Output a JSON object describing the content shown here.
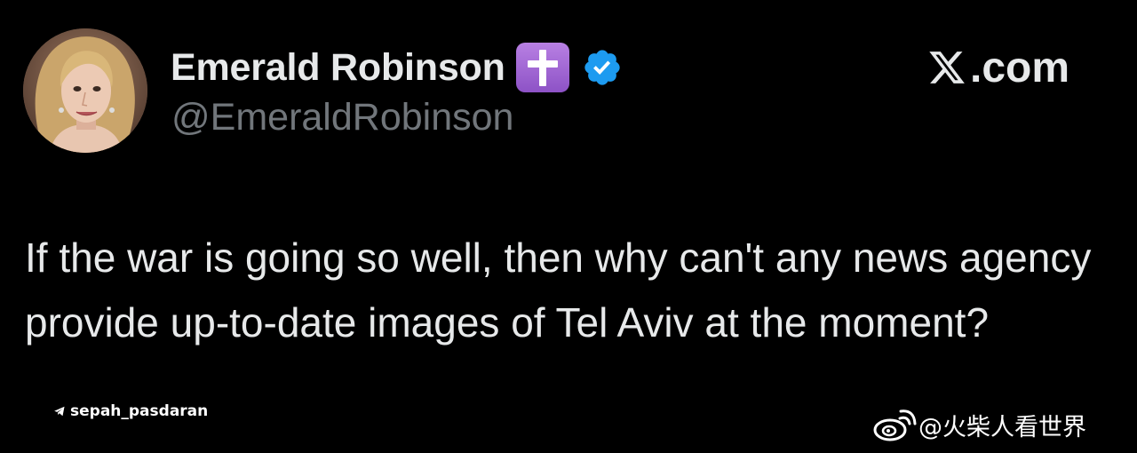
{
  "author": {
    "display_name": "Emerald Robinson",
    "handle": "@EmeraldRobinson",
    "name_emoji": "latin-cross-emoji",
    "verified_icon": "verified-badge-icon"
  },
  "brand": {
    "logo_icon": "x-logo-icon",
    "text": ".com"
  },
  "tweet": {
    "text": "If the war is going so well, then why can't any news agency provide up-to-date images of Tel Aviv at the moment?"
  },
  "watermarks": {
    "telegram": {
      "icon": "telegram-icon",
      "handle": "sepah_pasdaran"
    },
    "weibo": {
      "icon": "weibo-icon",
      "handle": "@火柴人看世界"
    }
  },
  "colors": {
    "background": "#000000",
    "primary_text": "#e7e9ea",
    "secondary_text": "#71767b",
    "verified_blue": "#1d9bf0",
    "emoji_purple": "#a36ad8"
  }
}
